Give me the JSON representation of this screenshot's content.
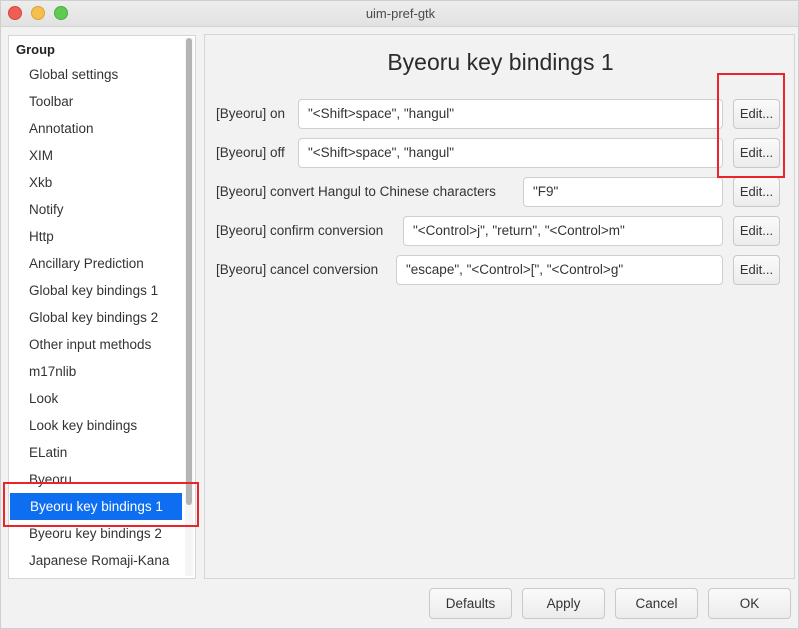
{
  "window": {
    "title": "uim-pref-gtk"
  },
  "sidebar": {
    "header": "Group",
    "items": [
      {
        "label": "Global settings"
      },
      {
        "label": "Toolbar"
      },
      {
        "label": "Annotation"
      },
      {
        "label": "XIM"
      },
      {
        "label": "Xkb"
      },
      {
        "label": "Notify"
      },
      {
        "label": "Http"
      },
      {
        "label": "Ancillary Prediction"
      },
      {
        "label": "Global key bindings 1"
      },
      {
        "label": "Global key bindings 2"
      },
      {
        "label": "Other input methods"
      },
      {
        "label": "m17nlib"
      },
      {
        "label": "Look"
      },
      {
        "label": "Look key bindings"
      },
      {
        "label": "ELatin"
      },
      {
        "label": "Byeoru"
      },
      {
        "label": "Byeoru key bindings 1"
      },
      {
        "label": "Byeoru key bindings 2"
      },
      {
        "label": "Japanese Romaji-Kana"
      }
    ],
    "selected": "Byeoru key bindings 1"
  },
  "main": {
    "title": "Byeoru key bindings 1",
    "rows": [
      {
        "label": "[Byeoru] on",
        "value": "\"<Shift>space\", \"hangul\"",
        "button": "Edit..."
      },
      {
        "label": "[Byeoru] off",
        "value": "\"<Shift>space\", \"hangul\"",
        "button": "Edit..."
      },
      {
        "label": "[Byeoru] convert Hangul to Chinese characters",
        "value": "\"F9\"",
        "button": "Edit..."
      },
      {
        "label": "[Byeoru] confirm conversion",
        "value": "\"<Control>j\", \"return\", \"<Control>m\"",
        "button": "Edit..."
      },
      {
        "label": "[Byeoru] cancel conversion",
        "value": "\"escape\", \"<Control>[\", \"<Control>g\"",
        "button": "Edit..."
      }
    ]
  },
  "footer": {
    "defaults": "Defaults",
    "apply": "Apply",
    "cancel": "Cancel",
    "ok": "OK"
  },
  "colors": {
    "selection": "#0e6ef2",
    "highlight": "#e8252b"
  }
}
